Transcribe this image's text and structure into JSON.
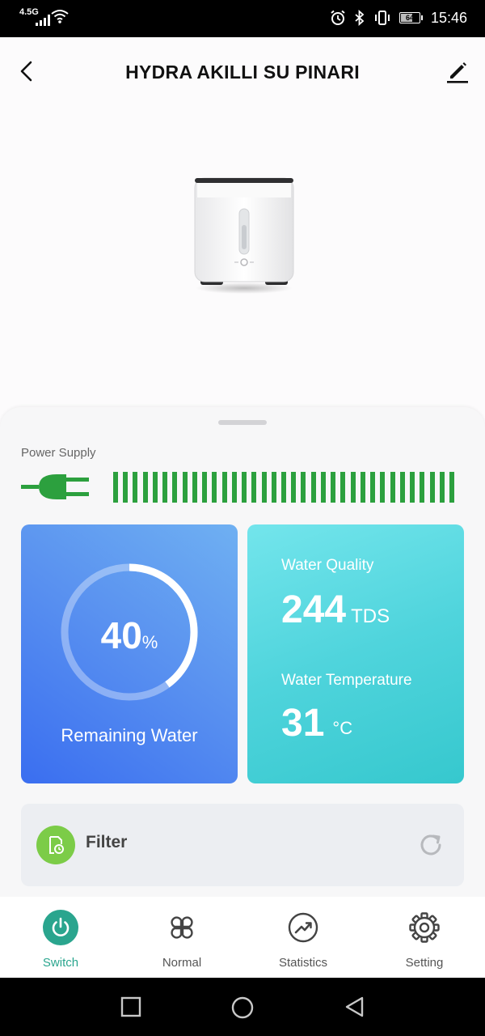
{
  "status_bar": {
    "network": "4.5G",
    "battery": "64",
    "time": "15:46"
  },
  "header": {
    "title": "HYDRA AKILLI SU PINARI",
    "back_icon": "chevron-left-icon",
    "edit_icon": "pencil-icon"
  },
  "power_supply": {
    "label": "Power Supply",
    "icon": "plug-icon",
    "level": 1.0,
    "bar_color": "#2ca03e"
  },
  "remaining_water": {
    "value": "40",
    "unit": "%",
    "fraction": 0.4,
    "label": "Remaining Water"
  },
  "water_quality": {
    "label": "Water Quality",
    "value": "244",
    "unit": "TDS"
  },
  "water_temperature": {
    "label": "Water Temperature",
    "value": "31",
    "unit": "°C"
  },
  "filter": {
    "label": "Filter",
    "icon": "filter-clock-icon",
    "action_icon": "refresh-icon"
  },
  "tabs": [
    {
      "label": "Switch",
      "icon": "power-icon",
      "active": true
    },
    {
      "label": "Normal",
      "icon": "grid-icon",
      "active": false
    },
    {
      "label": "Statistics",
      "icon": "trend-icon",
      "active": false
    },
    {
      "label": "Setting",
      "icon": "gear-icon",
      "active": false
    }
  ],
  "colors": {
    "accent": "#2aa58e",
    "water_card": "#4a82f0",
    "quality_card": "#4fd4dc",
    "filter_icon": "#7ccc48"
  }
}
